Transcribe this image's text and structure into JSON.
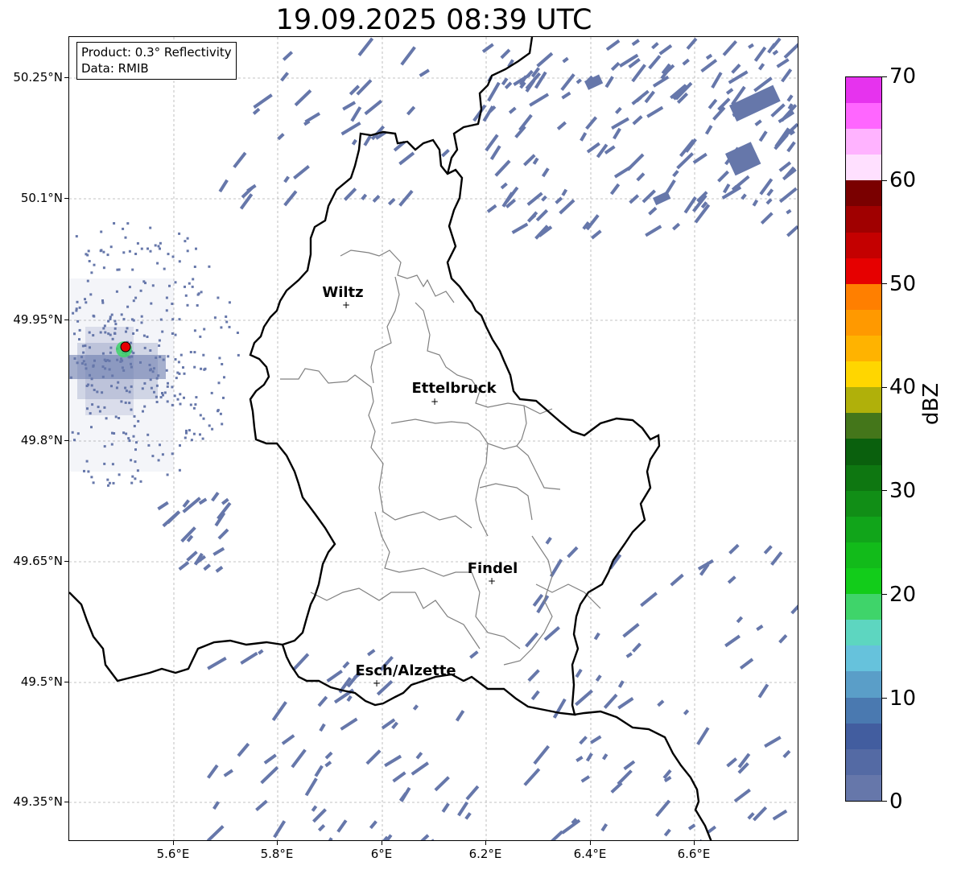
{
  "title": "19.09.2025 08:39 UTC",
  "info": {
    "product": "Product: 0.3° Reflectivity",
    "data": "Data: RMIB"
  },
  "axes": {
    "lat_ticks": [
      "50.25°N",
      "50.1°N",
      "49.95°N",
      "49.8°N",
      "49.65°N",
      "49.5°N",
      "49.35°N"
    ],
    "lon_ticks": [
      "5.6°E",
      "5.8°E",
      "6°E",
      "6.2°E",
      "6.4°E",
      "6.6°E"
    ]
  },
  "cities": [
    {
      "name": "Wiltz"
    },
    {
      "name": "Ettelbruck"
    },
    {
      "name": "Findel"
    },
    {
      "name": "Esch/Alzette"
    }
  ],
  "colorbar": {
    "unit": "dBZ",
    "tick_labels": [
      "0",
      "10",
      "20",
      "30",
      "40",
      "50",
      "60",
      "70"
    ],
    "colors": [
      "#6677aa",
      "#546aa4",
      "#425d9f",
      "#4a79b0",
      "#5a9ec8",
      "#66c2dc",
      "#5dd6c0",
      "#3fd46a",
      "#12cc1a",
      "#12bb1a",
      "#11a51a",
      "#118e16",
      "#0e7711",
      "#0a600d",
      "#44761a",
      "#b0b00a",
      "#ffd600",
      "#ffb300",
      "#ff9900",
      "#ff7f00",
      "#e60000",
      "#c40000",
      "#a00000",
      "#7a0000",
      "#ffe0ff",
      "#ffb3ff",
      "#ff66ff",
      "#e633ee"
    ]
  }
}
